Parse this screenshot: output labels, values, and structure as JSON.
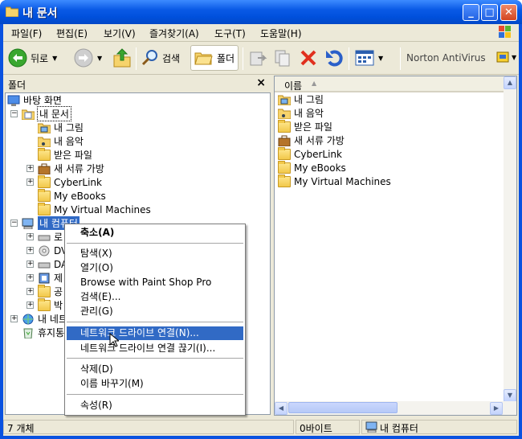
{
  "window": {
    "title": "내 문서"
  },
  "menu": [
    "파일(F)",
    "편집(E)",
    "보기(V)",
    "즐겨찾기(A)",
    "도구(T)",
    "도움말(H)"
  ],
  "toolbar": {
    "back": "뒤로",
    "search": "검색",
    "folders": "폴더",
    "norton": "Norton AntiVirus"
  },
  "folder_pane": {
    "title": "폴더",
    "close": "×"
  },
  "tree": [
    {
      "label": "바탕 화면",
      "icon": "desktop-icon"
    },
    {
      "label": "내 문서",
      "icon": "my-documents-icon"
    },
    {
      "label": "내 그림",
      "icon": "my-pictures-icon"
    },
    {
      "label": "내 음악",
      "icon": "my-music-icon"
    },
    {
      "label": "받은 파일",
      "icon": "folder-icon"
    },
    {
      "label": "새 서류 가방",
      "icon": "briefcase-icon"
    },
    {
      "label": "CyberLink",
      "icon": "folder-icon"
    },
    {
      "label": "My eBooks",
      "icon": "folder-icon"
    },
    {
      "label": "My Virtual Machines",
      "icon": "folder-icon"
    },
    {
      "label": "내 컴퓨터",
      "icon": "my-computer-icon"
    },
    {
      "label": "로",
      "icon": "drive-icon"
    },
    {
      "label": "DV",
      "icon": "cd-drive-icon"
    },
    {
      "label": "DA",
      "icon": "drive-icon"
    },
    {
      "label": "제",
      "icon": "control-panel-icon"
    },
    {
      "label": "공",
      "icon": "folder-icon"
    },
    {
      "label": "박",
      "icon": "folder-icon"
    },
    {
      "label": "내 네트",
      "icon": "network-icon"
    },
    {
      "label": "휴지통",
      "icon": "recycle-bin-icon"
    }
  ],
  "list": {
    "column": "이름",
    "items": [
      "내 그림",
      "내 음악",
      "받은 파일",
      "새 서류 가방",
      "CyberLink",
      "My eBooks",
      "My Virtual Machines"
    ]
  },
  "context_menu": {
    "items": [
      "축소(A)",
      "탐색(X)",
      "열기(O)",
      "Browse with Paint Shop Pro",
      "검색(E)...",
      "관리(G)",
      "네트워크 드라이브 연결(N)...",
      "네트워크 드라이브 연결 끊기(I)...",
      "삭제(D)",
      "이름 바꾸기(M)",
      "속성(R)"
    ]
  },
  "status": {
    "count": "7 개체",
    "size": "0바이트",
    "location": "내 컴퓨터"
  }
}
